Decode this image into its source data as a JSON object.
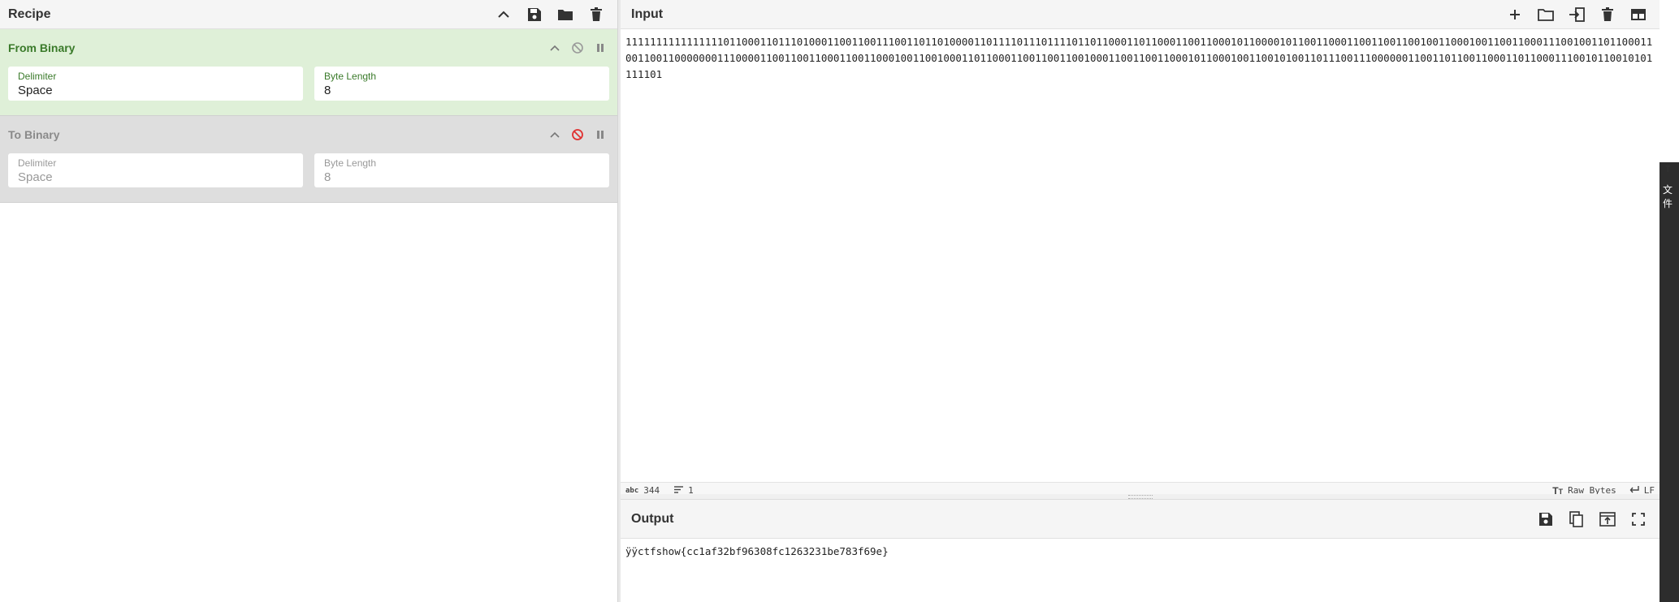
{
  "recipe": {
    "title": "Recipe",
    "operations": [
      {
        "name": "From Binary",
        "state": "active",
        "args": [
          {
            "label": "Delimiter",
            "value": "Space"
          },
          {
            "label": "Byte Length",
            "value": "8"
          }
        ]
      },
      {
        "name": "To Binary",
        "state": "disabled",
        "args": [
          {
            "label": "Delimiter",
            "value": "Space"
          },
          {
            "label": "Byte Length",
            "value": "8"
          }
        ]
      }
    ]
  },
  "input": {
    "title": "Input",
    "text": "111111111111111101100011011101000110011001110011011010000110111101110111101101100011011000110011000101100001011001100011001100110010011000100110011000111001001101100011001100110000000111000011001100110001100110001001100100011011000110011001100100011001100110001011000100110010100110111001110000001100110110011000110110001110010110010101111101",
    "stats": {
      "length": "344",
      "lines": "1"
    },
    "encoding": "Raw Bytes",
    "eol": "LF"
  },
  "output": {
    "title": "Output",
    "text": "ÿÿctfshow{cc1af32bf96308fc1263231be783f69e}"
  },
  "side": {
    "t": "T",
    "cjk": "文件"
  },
  "colors": {
    "active_bg": "#dff0d8",
    "active_text": "#3a7a2a",
    "disabled_bg": "#dedede",
    "disable_icon_red": "#e03030"
  },
  "icons": {
    "recipe_header": [
      "chevron-up-icon",
      "save-icon",
      "folder-icon",
      "trash-icon"
    ],
    "input_header": [
      "plus-icon",
      "folder-open-icon",
      "import-icon",
      "trash-icon",
      "layout-icon"
    ],
    "output_header": [
      "save-icon",
      "copy-icon",
      "replace-input-icon",
      "maximize-icon"
    ]
  }
}
